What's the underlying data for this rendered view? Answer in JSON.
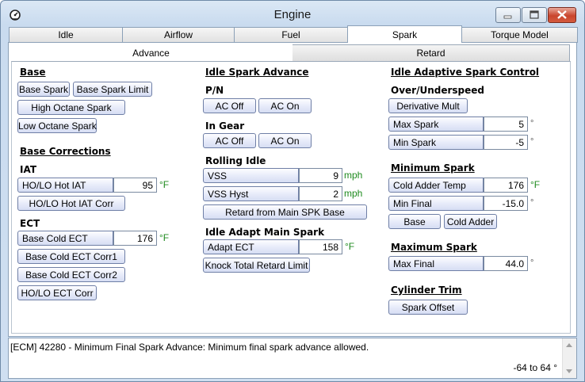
{
  "window": {
    "title": "Engine"
  },
  "tabs": [
    "Idle",
    "Airflow",
    "Fuel",
    "Spark",
    "Torque Model"
  ],
  "subtabs": [
    "Advance",
    "Retard"
  ],
  "col1": {
    "base_heading": "Base",
    "base_spark": "Base Spark",
    "base_spark_limit": "Base Spark Limit",
    "high_octane": "High Octane Spark",
    "low_octane": "Low Octane Spark",
    "corrections_heading": "Base Corrections",
    "iat_heading": "IAT",
    "holo_hot_iat": "HO/LO Hot IAT",
    "holo_hot_iat_value": "95",
    "holo_hot_iat_unit": "°F",
    "holo_hot_iat_corr": "HO/LO Hot IAT Corr",
    "ect_heading": "ECT",
    "base_cold_ect": "Base Cold ECT",
    "base_cold_ect_value": "176",
    "base_cold_ect_unit": "°F",
    "base_cold_ect_corr1": "Base Cold ECT Corr1",
    "base_cold_ect_corr2": "Base Cold ECT Corr2",
    "holo_ect_corr": "HO/LO ECT Corr"
  },
  "col2": {
    "idle_spark_heading": "Idle Spark Advance",
    "pn_heading": "P/N",
    "ac_off": "AC Off",
    "ac_on": "AC On",
    "in_gear_heading": "In Gear",
    "rolling_idle_heading": "Rolling Idle",
    "vss": "VSS",
    "vss_value": "9",
    "vss_unit": "mph",
    "vss_hyst": "VSS Hyst",
    "vss_hyst_value": "2",
    "vss_hyst_unit": "mph",
    "retard_from_main": "Retard from Main SPK Base",
    "idle_adapt_heading": "Idle Adapt Main Spark",
    "adapt_ect": "Adapt ECT",
    "adapt_ect_value": "158",
    "adapt_ect_unit": "°F",
    "knock_total": "Knock Total Retard Limit"
  },
  "col3": {
    "adaptive_heading": "Idle Adaptive Spark Control",
    "over_under_heading": "Over/Underspeed",
    "derivative_mult": "Derivative Mult",
    "max_spark": "Max Spark",
    "max_spark_value": "5",
    "min_spark": "Min Spark",
    "min_spark_value": "-5",
    "deg_unit": "°",
    "minimum_spark_heading": "Minimum Spark",
    "cold_adder_temp": "Cold Adder Temp",
    "cold_adder_temp_value": "176",
    "cold_adder_temp_unit": "°F",
    "min_final": "Min Final",
    "min_final_value": "-15.0",
    "base_btn": "Base",
    "cold_adder_btn": "Cold Adder",
    "maximum_spark_heading": "Maximum Spark",
    "max_final": "Max Final",
    "max_final_value": "44.0",
    "cylinder_trim_heading": "Cylinder Trim",
    "spark_offset": "Spark Offset"
  },
  "status": {
    "text": "[ECM] 42280 - Minimum Final Spark Advance: Minimum final spark advance allowed.",
    "range": "-64 to 64 °"
  }
}
